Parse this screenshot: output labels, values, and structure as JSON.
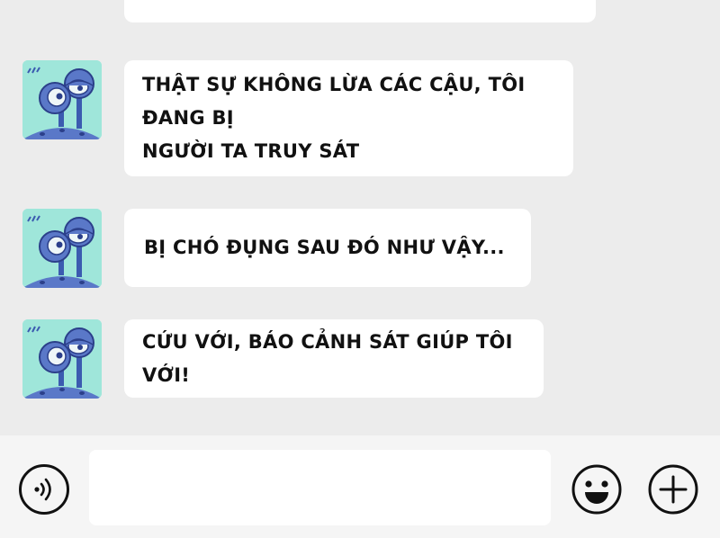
{
  "messages": [
    {
      "text_line1": "THẬT SỰ KHÔNG LỪA CÁC CẬU, TÔI ĐANG BỊ",
      "text_line2": "NGƯỜI TA TRUY SÁT"
    },
    {
      "text": "BỊ CHÓ ĐỤNG SAU ĐÓ NHƯ VẬY..."
    },
    {
      "text": "CỨU VỚI, BÁO CẢNH SÁT GIÚP TÔI VỚI!"
    }
  ],
  "input_bar": {
    "message_value": "",
    "voice_icon": "voice-wave-icon",
    "emoji_icon": "smiley-face-icon",
    "add_icon": "plus-icon"
  },
  "avatar_icon": "cartoon-eyes-avatar",
  "colors": {
    "chat_background": "#ececec",
    "bubble": "#ffffff",
    "input_bar": "#f5f5f5",
    "avatar_background": "#9fe6da",
    "avatar_figure": "#5a78c8"
  }
}
